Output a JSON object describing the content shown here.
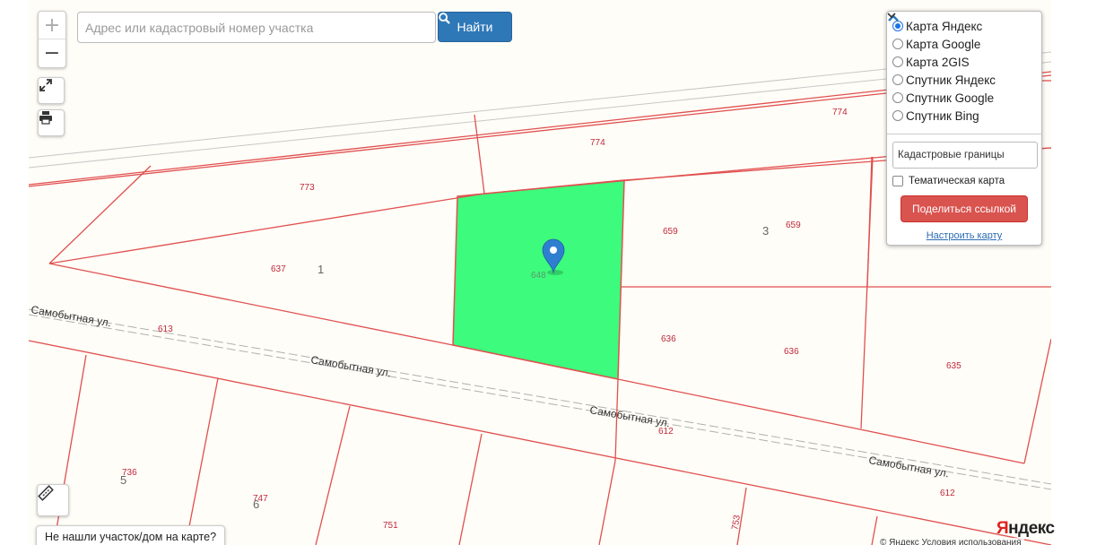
{
  "search": {
    "placeholder": "Адрес или кадастровый номер участка",
    "button_label": "Найти"
  },
  "zoom": {
    "plus": "+",
    "minus": "−"
  },
  "layers": {
    "base_maps": [
      {
        "label": "Карта Яндекс",
        "selected": true
      },
      {
        "label": "Карта Google",
        "selected": false
      },
      {
        "label": "Карта 2GIS",
        "selected": false
      },
      {
        "label": "Спутник Яндекс",
        "selected": false
      },
      {
        "label": "Спутник Google",
        "selected": false
      },
      {
        "label": "Спутник Bing",
        "selected": false
      }
    ],
    "overlay_select": "Кадастровые границы",
    "thematic_label": "Тематическая карта",
    "thematic_checked": false,
    "share_button": "Поделиться ссылкой",
    "settings_link": "Настроить карту"
  },
  "map": {
    "selected_parcel_color": "#3dfb7c",
    "boundary_color": "#e05050",
    "parcel_labels": [
      "774",
      "774",
      "773",
      "659",
      "659",
      "637",
      "648",
      "613",
      "636",
      "636",
      "635",
      "612",
      "612",
      "736",
      "747",
      "751",
      "753"
    ],
    "quarter_labels": [
      "1",
      "3",
      "5",
      "6"
    ],
    "street_name": "Самобытная ул."
  },
  "not_found_button": "Не нашли участок/дом на карте?",
  "logo": {
    "first": "Я",
    "rest": "ндекс"
  },
  "copyright": "© Яндекс Условия использования"
}
